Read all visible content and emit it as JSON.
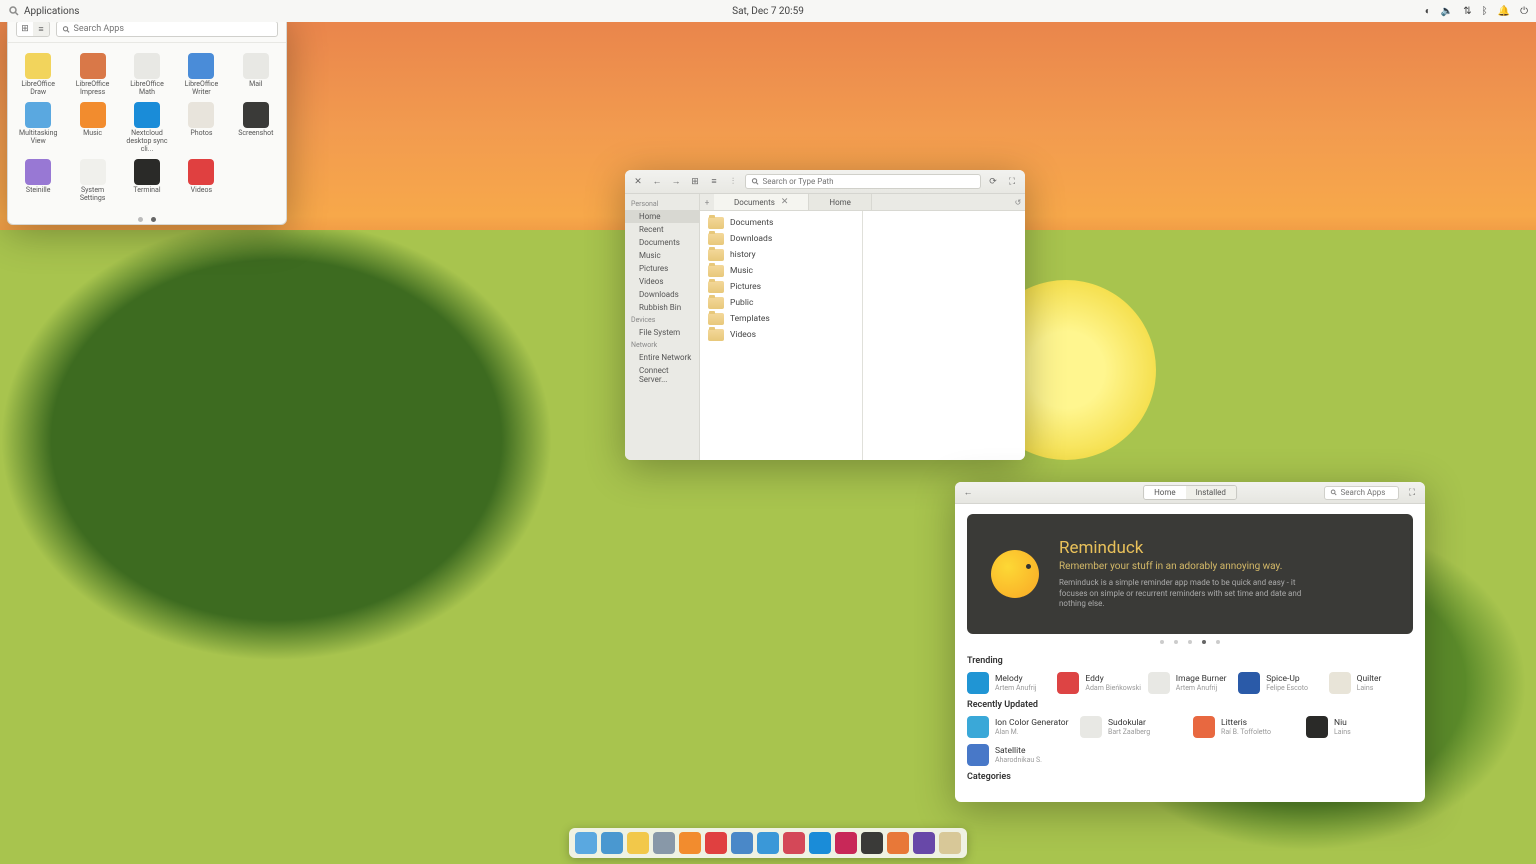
{
  "topbar": {
    "apps_label": "Applications",
    "datetime": "Sat, Dec 7   20:59"
  },
  "apps_window": {
    "search_placeholder": "Search Apps",
    "items": [
      {
        "label": "LibreOffice Draw",
        "color": "#f2d45c"
      },
      {
        "label": "LibreOffice Impress",
        "color": "#d97848"
      },
      {
        "label": "LibreOffice Math",
        "color": "#e8e8e4"
      },
      {
        "label": "LibreOffice Writer",
        "color": "#4a8cd8"
      },
      {
        "label": "Mail",
        "color": "#e8e8e4"
      },
      {
        "label": "Multitasking View",
        "color": "#5aa8e0"
      },
      {
        "label": "Music",
        "color": "#f28c2e"
      },
      {
        "label": "Nextcloud desktop sync cli...",
        "color": "#1a8cd8"
      },
      {
        "label": "Photos",
        "color": "#e8e4dc"
      },
      {
        "label": "Screenshot",
        "color": "#3a3a38"
      },
      {
        "label": "Steinille",
        "color": "#9878d4"
      },
      {
        "label": "System Settings",
        "color": "#f0f0ec"
      },
      {
        "label": "Terminal",
        "color": "#2a2a28"
      },
      {
        "label": "Videos",
        "color": "#e04040"
      }
    ]
  },
  "files_window": {
    "path_placeholder": "Search or Type Path",
    "sidebar": {
      "personal_label": "Personal",
      "personal": [
        {
          "label": "Home",
          "active": true
        },
        {
          "label": "Recent"
        },
        {
          "label": "Documents"
        },
        {
          "label": "Music"
        },
        {
          "label": "Pictures"
        },
        {
          "label": "Videos"
        },
        {
          "label": "Downloads"
        },
        {
          "label": "Rubbish Bin"
        }
      ],
      "devices_label": "Devices",
      "devices": [
        {
          "label": "File System"
        }
      ],
      "network_label": "Network",
      "network": [
        {
          "label": "Entire Network"
        },
        {
          "label": "Connect Server..."
        }
      ]
    },
    "tabs": [
      {
        "label": "Documents",
        "close": true
      },
      {
        "label": "Home"
      }
    ],
    "folders": [
      "Documents",
      "Downloads",
      "history",
      "Music",
      "Pictures",
      "Public",
      "Templates",
      "Videos"
    ]
  },
  "appcenter": {
    "nav": [
      "Home",
      "Installed"
    ],
    "search_placeholder": "Search Apps",
    "banner": {
      "title": "Reminduck",
      "subtitle": "Remember your stuff in an adorably annoying way.",
      "description": "Reminduck is a simple reminder app made to be quick and easy - it focuses on simple or recurrent reminders with set time and date and nothing else."
    },
    "trending_label": "Trending",
    "trending": [
      {
        "name": "Melody",
        "author": "Artem Anufrij",
        "color": "#2095d4"
      },
      {
        "name": "Eddy",
        "author": "Adam Bieńkowski",
        "color": "#d44"
      },
      {
        "name": "Image Burner",
        "author": "Artem Anufrij",
        "color": "#e8e8e4"
      },
      {
        "name": "Spice-Up",
        "author": "Felipe Escoto",
        "color": "#2a5aa8"
      },
      {
        "name": "Quilter",
        "author": "Lains",
        "color": "#e8e4d8"
      }
    ],
    "recent_label": "Recently Updated",
    "recent": [
      {
        "name": "Ion Color Generator",
        "author": "Alan M.",
        "color": "#3aa8d8"
      },
      {
        "name": "Sudokular",
        "author": "Bart Zaalberg",
        "color": "#e8e8e4"
      },
      {
        "name": "Litteris",
        "author": "Raí B. Toffoletto",
        "color": "#e86840"
      },
      {
        "name": "Niu",
        "author": "Lains",
        "color": "#2a2a28"
      },
      {
        "name": "Satellite",
        "author": "Aharodnikau S.",
        "color": "#4878c8"
      }
    ],
    "categories_label": "Categories"
  },
  "dock": [
    {
      "color": "#5aa8e0"
    },
    {
      "color": "#4a98d0"
    },
    {
      "color": "#f2c84a"
    },
    {
      "color": "#8898a8"
    },
    {
      "color": "#f28c2e"
    },
    {
      "color": "#e04040"
    },
    {
      "color": "#4a88c8"
    },
    {
      "color": "#3a98d8"
    },
    {
      "color": "#d44858"
    },
    {
      "color": "#1a8cd8"
    },
    {
      "color": "#c82858"
    },
    {
      "color": "#3a3a38"
    },
    {
      "color": "#e87838"
    },
    {
      "color": "#6848a8"
    },
    {
      "color": "#d8c898"
    }
  ]
}
